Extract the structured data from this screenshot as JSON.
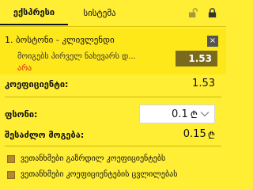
{
  "tabs": {
    "active": "ექსპრესი",
    "system": "სისტემა"
  },
  "icons": {
    "unlock": "unlock-icon",
    "lock": "lock-icon"
  },
  "bet": {
    "title": "1. ბოსტონი - კლივლენდი",
    "close": "×",
    "market": "მოიგებს პირველ ნახევარს დ...",
    "selection": "არა",
    "odd": "1.53"
  },
  "summary": {
    "coef_label": "კოეფიციენტი:",
    "coef_value": "1.53",
    "stake_label": "ფსონი:",
    "stake_value": "0.1",
    "stake_currency": "₾",
    "win_label": "შესაძლო მოგება:",
    "win_value": "0.15",
    "win_currency": "₾"
  },
  "options": [
    {
      "label": "ვეთანხმები გაზრდილ კოეფიციენტებს"
    },
    {
      "label": "ვეთანხმები კოეფიციენტების ცვლილებას"
    }
  ],
  "colors": {
    "background": "#ffee33",
    "odd_button": "#7a6a1e",
    "selection": "#d41b1b"
  }
}
